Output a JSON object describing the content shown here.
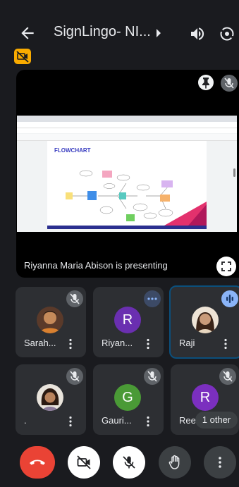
{
  "header": {
    "title": "SignLingo- NI...",
    "back_icon": "back-arrow-icon",
    "speaker_icon": "speaker-icon",
    "flip_camera_icon": "flip-camera-icon",
    "camera_off_indicator": "camera-off-icon"
  },
  "presentation": {
    "label": "Riyanna Maria Abison is presenting",
    "slide_title": "FLOWCHART"
  },
  "participants": [
    {
      "name": "Sarah...",
      "status": "muted"
    },
    {
      "name": "Riyan...",
      "initial": "R",
      "avatar_color": "#6a2fb0",
      "status": "more-options"
    },
    {
      "name": "Raji",
      "status": "speaking"
    },
    {
      "name": ".",
      "status": "muted"
    },
    {
      "name": "Gauri...",
      "initial": "G",
      "avatar_color": "#4a9a36",
      "status": "muted"
    },
    {
      "name": "Ree",
      "initial": "R",
      "avatar_color": "#7b2fbf",
      "status": "muted"
    }
  ],
  "others": {
    "label": "1 other"
  },
  "controls": {
    "end_call": "end-call-icon",
    "camera": "camera-off-icon",
    "mic": "mic-off-icon",
    "hand": "raise-hand-icon",
    "more": "more-vert-icon"
  },
  "colors": {
    "background": "#1a1b1f",
    "end_call": "#ea4335",
    "warning_badge": "#f9ab00",
    "tile": "#2d2f33"
  }
}
